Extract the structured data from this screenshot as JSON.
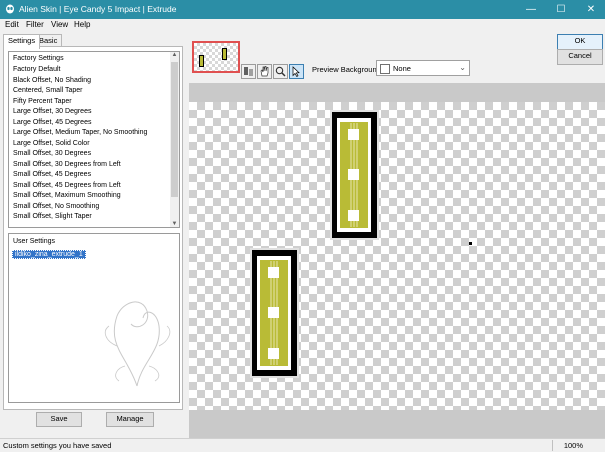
{
  "window": {
    "title": "Alien Skin | Eye Candy 5 Impact | Extrude",
    "minimize_glyph": "—",
    "maximize_glyph": "☐",
    "close_glyph": "✕"
  },
  "menu": [
    "Edit",
    "Filter",
    "View",
    "Help"
  ],
  "tabs": [
    "Settings",
    "Basic"
  ],
  "factory": {
    "header": "Factory Settings",
    "items": [
      "Factory Default",
      "Black Offset, No Shading",
      "Centered, Small Taper",
      "Fifty Percent Taper",
      "Large Offset, 30 Degrees",
      "Large Offset, 45 Degrees",
      "Large Offset, Medium Taper, No Smoothing",
      "Large Offset, Solid Color",
      "Small Offset, 30 Degrees",
      "Small Offset, 30 Degrees from Left",
      "Small Offset, 45 Degrees",
      "Small Offset, 45 Degrees from Left",
      "Small Offset, Maximum Smoothing",
      "Small Offset, No Smoothing",
      "Small Offset, Slight Taper"
    ]
  },
  "user": {
    "header": "User Settings",
    "selected": "ildiko_zina_extrude_1"
  },
  "buttons": {
    "save": "Save",
    "manage": "Manage",
    "ok": "OK",
    "cancel": "Cancel"
  },
  "preview": {
    "label": "Preview Background:",
    "value": "None"
  },
  "tools": [
    "swap-icon",
    "hand-icon",
    "zoom-icon",
    "pointer-icon"
  ],
  "status": {
    "text": "Custom settings you have saved",
    "zoom": "100%"
  },
  "colors": {
    "titlebar": "#2b8ea6",
    "selection": "#3374c8",
    "object_fill": "#b9bb36",
    "object_border": "#000000"
  }
}
